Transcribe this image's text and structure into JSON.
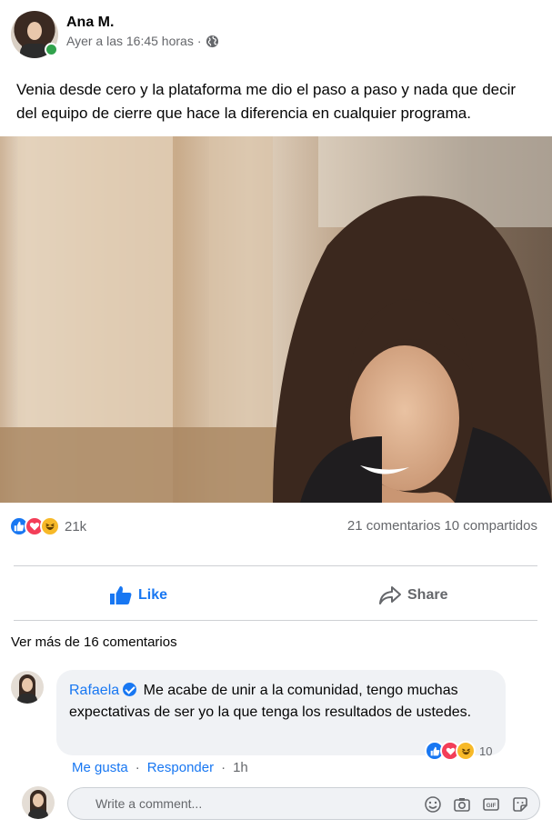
{
  "post": {
    "author": "Ana M.",
    "timestamp": "Ayer a las 16:45 horas",
    "separator": "·",
    "privacy_icon": "globe-icon",
    "text": "Venia desde cero y la plataforma me dio el paso a paso y nada que decir del equipo de cierre que hace la diferencia en cualquier programa."
  },
  "stats": {
    "reaction_icons": [
      "like-icon",
      "love-icon",
      "haha-icon"
    ],
    "reaction_count": "21k",
    "comments": "21 comentarios",
    "shares": "10 compartidos"
  },
  "actions": {
    "like_label": "Like",
    "share_label": "Share"
  },
  "comments": {
    "more_label": "Ver más de 16 comentarios",
    "items": [
      {
        "name": "Rafaela",
        "text": "Me acabe de unir a la comunidad, tengo muchas expectativas de ser yo la que tenga los resultados de ustedes.",
        "reaction_count": "10",
        "like_label": "Me gusta",
        "reply_label": "Responder",
        "time": "1h"
      }
    ]
  },
  "composer": {
    "placeholder": "Write a comment..."
  },
  "colors": {
    "accent": "#1877f2",
    "love": "#f33e58",
    "haha": "#f7b928",
    "online": "#31a24c",
    "muted_text": "#65676b"
  }
}
